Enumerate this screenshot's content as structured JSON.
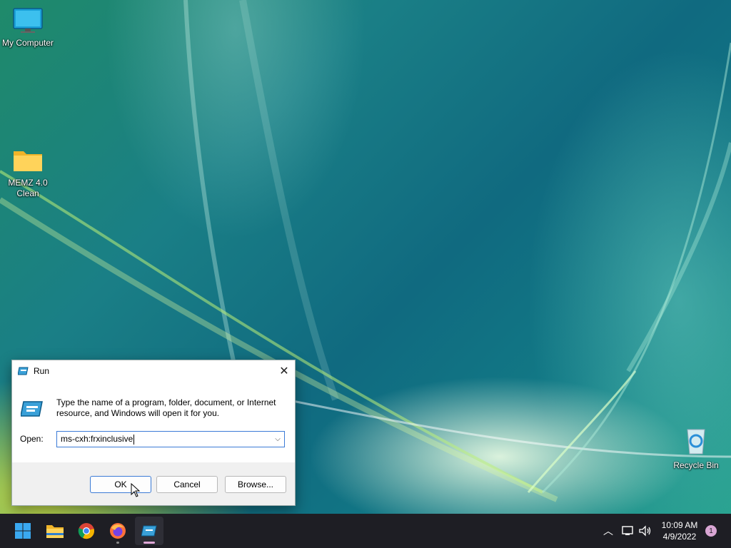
{
  "desktop": {
    "icons": [
      {
        "label": "My Computer",
        "icon": "monitor-icon"
      },
      {
        "label": "MEMZ 4.0 Clean",
        "icon": "folder-icon"
      },
      {
        "label": "Recycle Bin",
        "icon": "recycle-bin-icon"
      }
    ]
  },
  "run_dialog": {
    "title": "Run",
    "description": "Type the name of a program, folder, document, or Internet resource, and Windows will open it for you.",
    "open_label": "Open:",
    "open_value": "ms-cxh:frxinclusive",
    "buttons": {
      "ok": "OK",
      "cancel": "Cancel",
      "browse": "Browse..."
    }
  },
  "taskbar": {
    "apps": [
      "start-icon",
      "file-explorer-icon",
      "chrome-icon",
      "firefox-icon",
      "run-icon"
    ],
    "time": "10:09 AM",
    "date": "4/9/2022",
    "notification_count": "1"
  },
  "colors": {
    "accent": "#3b7bd6",
    "taskbar": "#1e1e24",
    "notif_badge": "#d9a6d4"
  }
}
